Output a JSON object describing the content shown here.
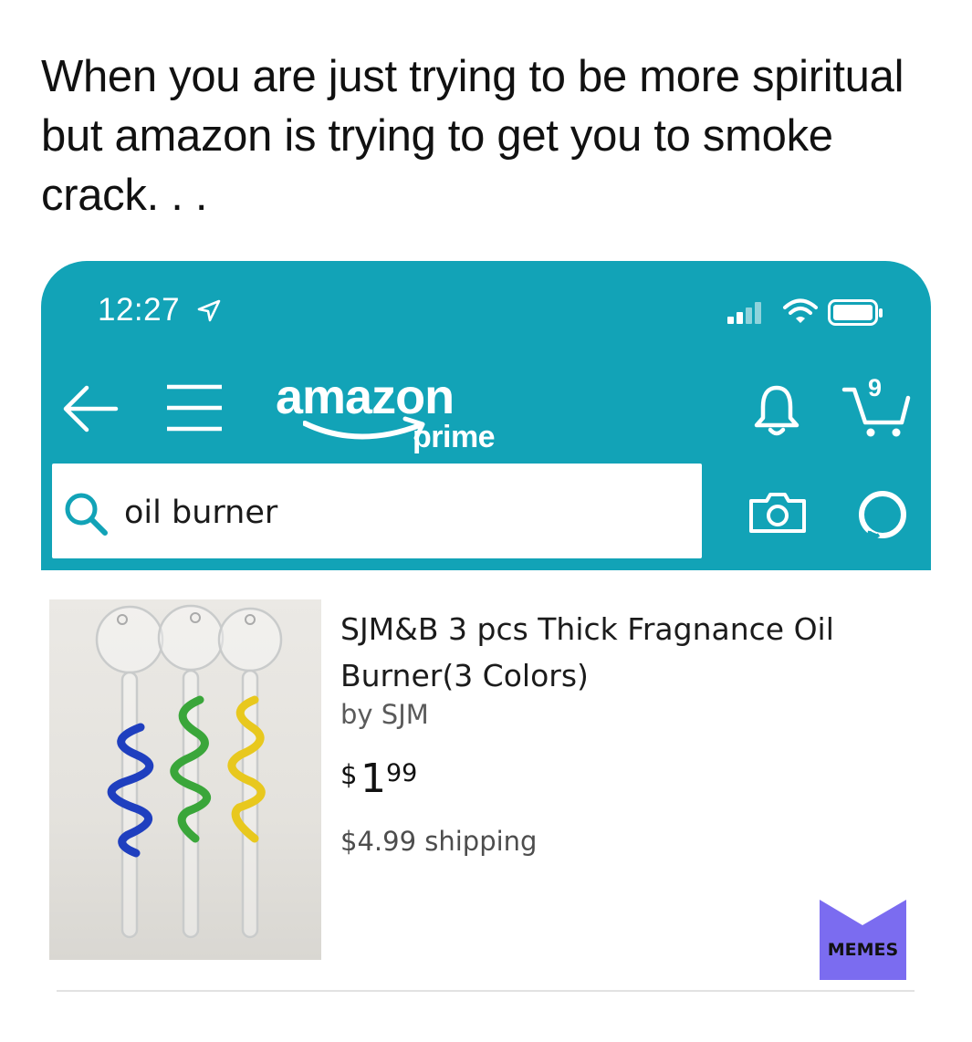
{
  "caption": "When you are just trying to be more spiritual but amazon is trying to get you to smoke crack. . .",
  "status_bar": {
    "time": "12:27",
    "icons": [
      "location-arrow-icon",
      "signal-icon",
      "wifi-icon",
      "battery-icon"
    ]
  },
  "header": {
    "logo_word": "amazon",
    "logo_sub": "prime",
    "cart_count": "9",
    "icons": [
      "back-arrow-icon",
      "hamburger-menu-icon",
      "bell-icon",
      "cart-icon"
    ]
  },
  "search": {
    "query": "oil burner",
    "icons": [
      "search-icon",
      "camera-icon",
      "alexa-icon"
    ]
  },
  "product": {
    "title": "SJM&B 3 pcs Thick Fragnance Oil Burner(3 Colors)",
    "by": "by SJM",
    "price_currency": "$",
    "price_whole": "1",
    "price_fraction": "99",
    "shipping": "$4.99 shipping"
  },
  "watermark": {
    "text": "MEMES"
  },
  "colors": {
    "header_bg": "#12a3b7",
    "watermark_bg": "#7b6cf0",
    "glass_blue": "#1f3fbf",
    "glass_green": "#3aa63a",
    "glass_yellow": "#e8c81e"
  }
}
